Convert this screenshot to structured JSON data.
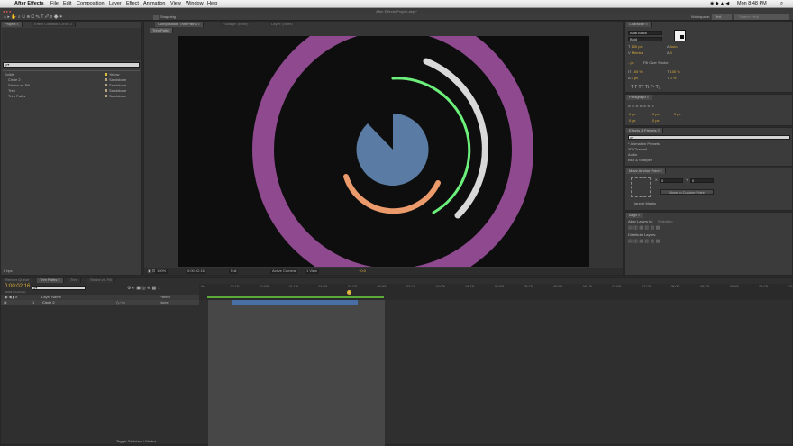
{
  "mac_menu": {
    "app": "After Effects",
    "items": [
      "File",
      "Edit",
      "Composition",
      "Layer",
      "Effect",
      "Animation",
      "View",
      "Window",
      "Help"
    ],
    "clock": "Mon 8:48 PM"
  },
  "window_title": "After Effects Project.aep *",
  "toolbar": {
    "snapping": "Snapping",
    "workspace_label": "Workspace:",
    "workspace_value": "Text",
    "search_placeholder": "Search Help"
  },
  "project": {
    "tab": "Project ≡",
    "tab2": "Effect Controls: Circle 2",
    "search": "ρ▾",
    "rows": [
      {
        "name": "Solids",
        "label": "Yellow"
      },
      {
        "name": "Circle 2",
        "label": "Sandstone"
      },
      {
        "name": "Stroke vs. Fill",
        "label": "Sandstone"
      },
      {
        "name": "Trim",
        "label": "Sandstone"
      },
      {
        "name": "Trim Paths",
        "label": "Sandstone"
      }
    ],
    "footer": "8 bpc"
  },
  "comp": {
    "tab": "Composition: Trim Paths ≡",
    "tab2": "Footage: (none)",
    "tab3": "Layer: (none)",
    "subtab": "Trim Paths",
    "zoom": "100%",
    "time": "0:00:02:16",
    "resolution": "Full",
    "camera": "Active Camera",
    "views": "1 View",
    "exposure": "+0.0"
  },
  "character": {
    "tab": "Character ≡",
    "font": "Arial Black",
    "style": "Bold",
    "size": "100 px",
    "leading": "Auto",
    "kerning": "Metrics",
    "tracking": "0",
    "stroke": "Fill Over Stroke",
    "stroke_px": "- px",
    "scale_v": "100 %",
    "scale_h": "100 %",
    "baseline": "0 px",
    "tsume": "0 %"
  },
  "paragraph": {
    "tab": "Paragraph ≡",
    "indent": [
      "0 px",
      "0 px",
      "0 px",
      "0 px",
      "0 px"
    ]
  },
  "effects": {
    "tab": "Effects & Presets ≡",
    "search": "ρ▾",
    "items": [
      "* Animation Presets",
      "3D Channel",
      "Audio",
      "Blur & Sharpen"
    ]
  },
  "anchor": {
    "tab": "Move Anchor Point ≡",
    "x": "0",
    "y": "0",
    "button": "Move to Custom Point",
    "ignore": "Ignore Masks"
  },
  "align": {
    "tab": "Align ≡",
    "align_to": "Align Layers to:",
    "align_value": "Selection",
    "distribute": "Distribute Layers:"
  },
  "timeline": {
    "tabs": [
      "Render Queue",
      "Trim Paths ≡",
      "Trim",
      "Stroke vs. Fill"
    ],
    "time": "0:00:02:16",
    "fps": "00066 (24.00 fps)",
    "search": "ρ▾",
    "col_name": "Layer Name",
    "col_parent": "Parent",
    "layer_num": "1",
    "layer_name": "Circle 2",
    "layer_parent": "None",
    "ticks": [
      "0s",
      "00:12f",
      "01:00f",
      "01:12f",
      "02:00f",
      "02:12f",
      "03:00f",
      "03:12f",
      "04:00f",
      "04:12f",
      "05:00f",
      "05:12f",
      "06:00f",
      "06:12f",
      "07:00f",
      "07:12f",
      "08:00f",
      "08:12f",
      "09:00f",
      "09:12f",
      "10:0"
    ],
    "toggle": "Toggle Switches / Modes"
  },
  "colors": {
    "purple": "#8f4a8f",
    "green": "#6df07b",
    "white": "#d9d9d9",
    "orange": "#ea9a6b",
    "blue": "#5a7ba3",
    "layer_bar": "#4a6ea6",
    "playhead": "#c2283a"
  }
}
